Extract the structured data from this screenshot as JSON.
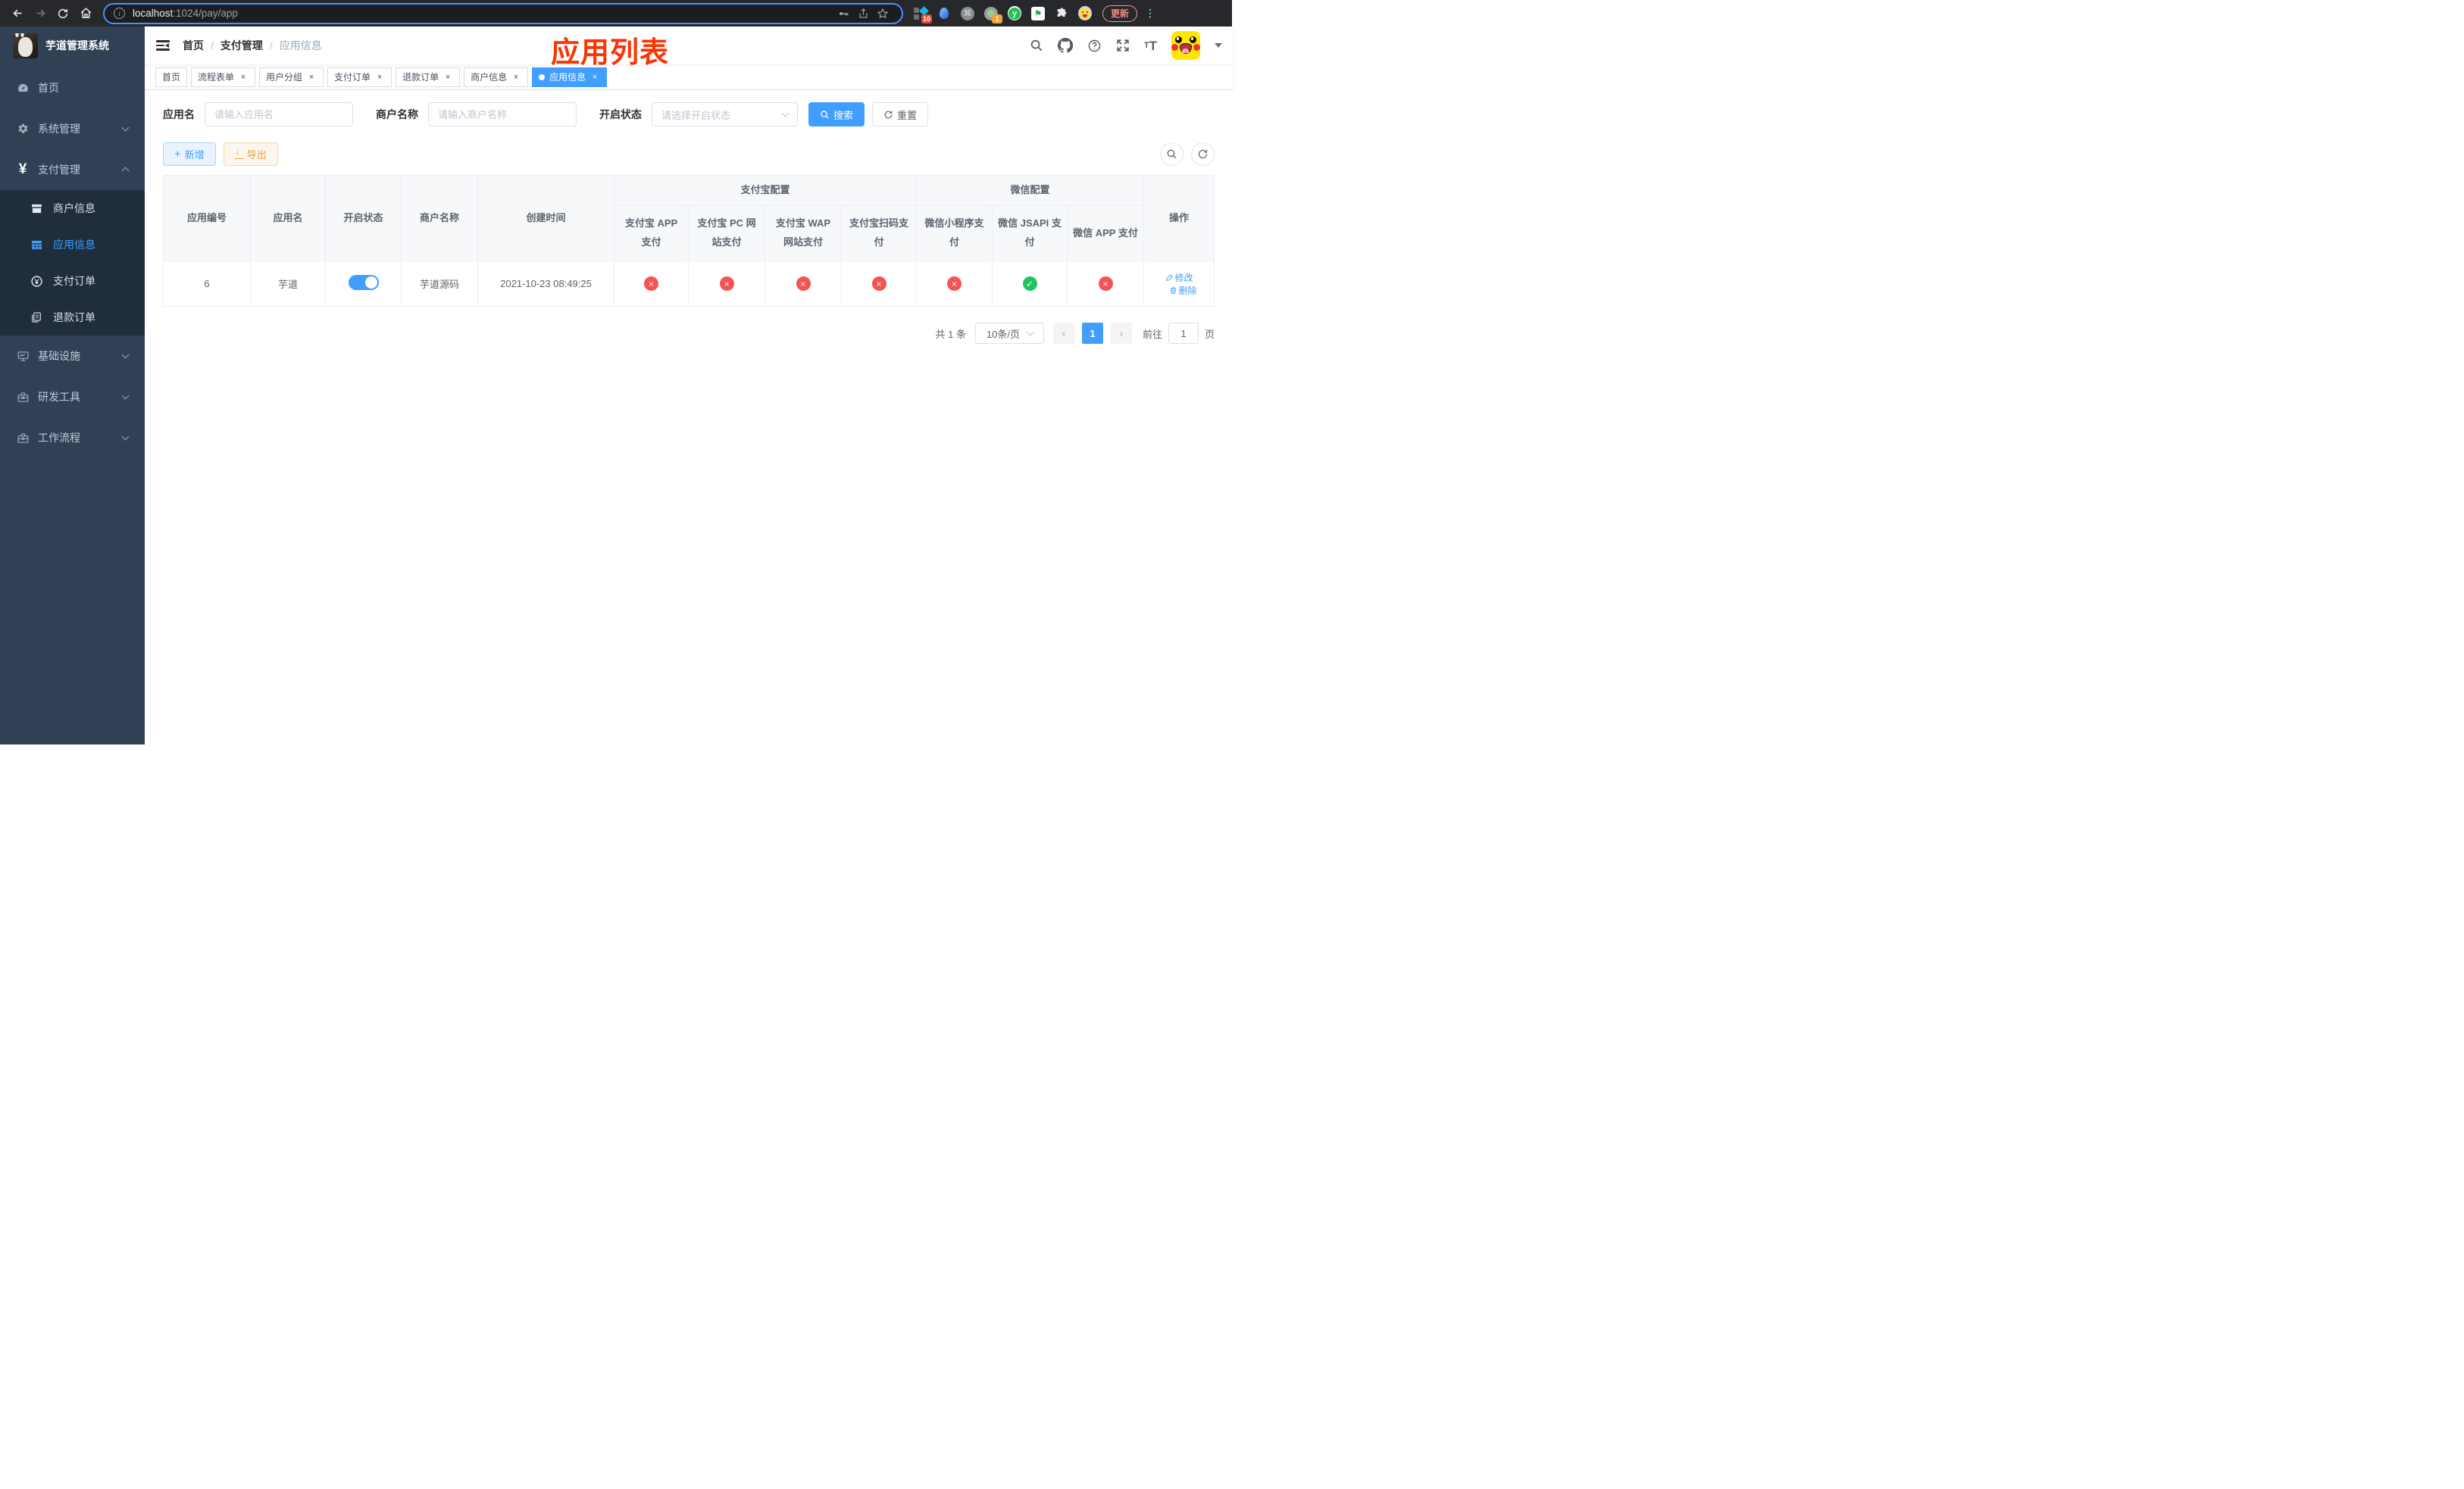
{
  "browser": {
    "url_host": "localhost",
    "url_path": ":1024/pay/app",
    "update_label": "更新",
    "ext_badge_blue_diamond": "10",
    "ext_badge_proxy": "1",
    "ext_y_letter": "y",
    "ext_flag_glyph": "⚑",
    "ext_command_glyph": "⌘"
  },
  "sidebar": {
    "title": "芋道管理系统",
    "menu": [
      {
        "label": "首页"
      },
      {
        "label": "系统管理"
      },
      {
        "label": "支付管理"
      },
      {
        "label": "基础设施"
      },
      {
        "label": "研发工具"
      },
      {
        "label": "工作流程"
      }
    ],
    "submenu": [
      {
        "label": "商户信息"
      },
      {
        "label": "应用信息"
      },
      {
        "label": "支付订单"
      },
      {
        "label": "退款订单"
      }
    ]
  },
  "header": {
    "breadcrumb": {
      "home": "首页",
      "section": "支付管理",
      "current": "应用信息"
    },
    "annotation": "应用列表"
  },
  "tags": {
    "items": [
      {
        "label": "首页"
      },
      {
        "label": "流程表单"
      },
      {
        "label": "用户分组"
      },
      {
        "label": "支付订单"
      },
      {
        "label": "退款订单"
      },
      {
        "label": "商户信息"
      },
      {
        "label": "应用信息"
      }
    ]
  },
  "filters": {
    "app_name_label": "应用名",
    "app_name_placeholder": "请输入应用名",
    "merchant_label": "商户名称",
    "merchant_placeholder": "请输入商户名称",
    "status_label": "开启状态",
    "status_placeholder": "请选择开启状态",
    "search_label": "搜索",
    "reset_label": "重置"
  },
  "toolbar": {
    "add_label": "新增",
    "export_label": "导出"
  },
  "table": {
    "headers": {
      "app_id": "应用编号",
      "app_name": "应用名",
      "status": "开启状态",
      "merchant": "商户名称",
      "created": "创建时间",
      "alipay_group": "支付宝配置",
      "wechat_group": "微信配置",
      "ops": "操作",
      "sub": [
        "支付宝 APP 支付",
        "支付宝 PC 网站支付",
        "支付宝 WAP 网站支付",
        "支付宝扫码支付",
        "微信小程序支付",
        "微信 JSAPI 支付",
        "微信 APP 支付"
      ]
    },
    "row": {
      "app_id": "6",
      "app_name": "芋道",
      "enabled": true,
      "merchant": "芋道源码",
      "created": "2021-10-23 08:49:25",
      "configs": [
        false,
        false,
        false,
        false,
        false,
        true,
        false
      ],
      "edit_label": "修改",
      "delete_label": "删除"
    }
  },
  "pagination": {
    "total": "共 1 条",
    "page_size": "10条/页",
    "current_page": "1",
    "goto_label": "前往",
    "goto_value": "1",
    "goto_unit": "页"
  },
  "colors": {
    "accent": "#409eff",
    "success": "#1ec45f",
    "danger": "#f45453",
    "warning": "#e6a23c",
    "annotation_red": "#fa3503",
    "sidebar_bg": "#304156",
    "submenu_bg": "#1f2d3d"
  }
}
